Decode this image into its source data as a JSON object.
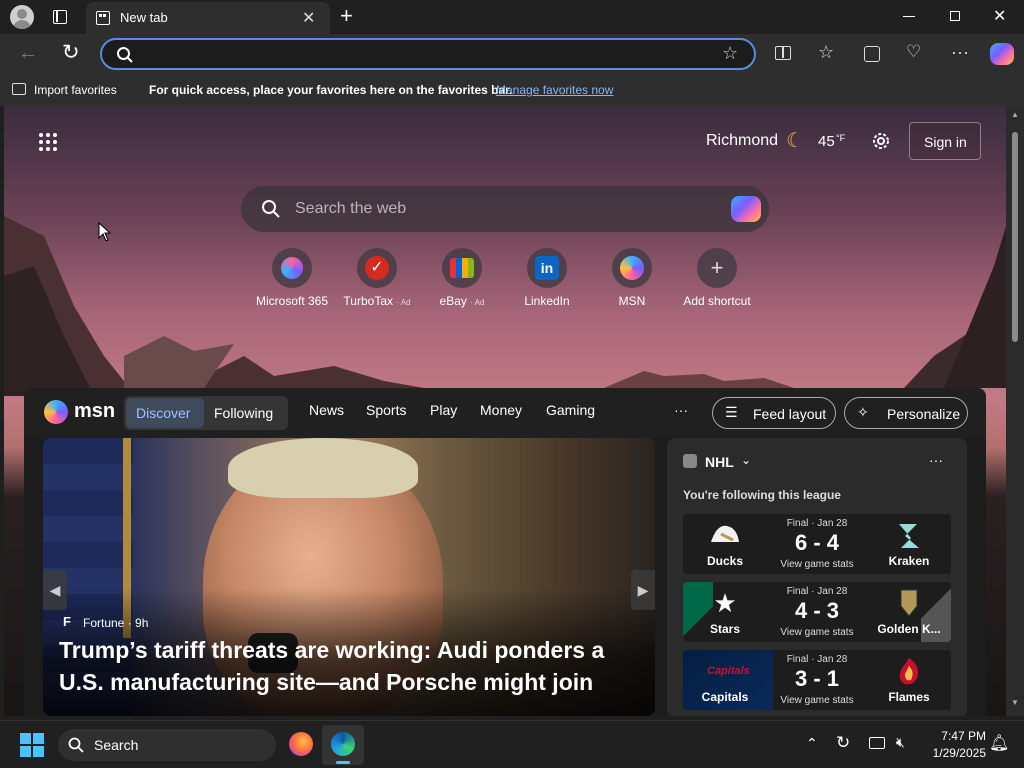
{
  "tab": {
    "title": "New tab",
    "new_tab_symbol": "+"
  },
  "address": {
    "value": "",
    "placeholder": ""
  },
  "favorites_bar": {
    "import_label": "Import favorites",
    "hint": "For quick access, place your favorites here on the favorites bar.",
    "manage_link": "Manage favorites now"
  },
  "weather": {
    "city": "Richmond",
    "temp": "45",
    "unit": "°F"
  },
  "sign_in_label": "Sign in",
  "web_search": {
    "placeholder": "Search the web"
  },
  "shortcuts": [
    {
      "label": "Microsoft 365",
      "ad": ""
    },
    {
      "label": "TurboTax",
      "ad": "· Ad"
    },
    {
      "label": "eBay",
      "ad": "· Ad"
    },
    {
      "label": "LinkedIn",
      "ad": ""
    },
    {
      "label": "MSN",
      "ad": ""
    },
    {
      "label": "Add shortcut",
      "ad": ""
    }
  ],
  "feed": {
    "brand": "msn",
    "tabs": [
      "Discover",
      "Following"
    ],
    "nav": [
      "News",
      "Sports",
      "Play",
      "Money",
      "Gaming"
    ],
    "more": "···",
    "feed_layout_label": "Feed layout",
    "personalize_label": "Personalize"
  },
  "hero": {
    "source_initial": "F",
    "source": "Fortune · 9h",
    "headline": "Trump’s tariff threats are working: Audi ponders a U.S. manufacturing site—and Porsche might join"
  },
  "nhl": {
    "league": "NHL",
    "subtitle": "You're following this league",
    "more": "···",
    "games": [
      {
        "status": "Final · Jan 28",
        "team1": "Ducks",
        "score": "6 - 4",
        "team2": "Kraken",
        "stats": "View game stats"
      },
      {
        "status": "Final · Jan 28",
        "team1": "Stars",
        "score": "4 - 3",
        "team2": "Golden K...",
        "stats": "View game stats"
      },
      {
        "status": "Final · Jan 28",
        "team1": "Capitals",
        "score": "3 - 1",
        "team2": "Flames",
        "stats": "View game stats"
      }
    ]
  },
  "taskbar": {
    "search_label": "Search",
    "time": "7:47 PM",
    "date": "1/29/2025"
  },
  "colors": {
    "accent": "#5b8be0",
    "link": "#8ab4f8",
    "discover": "#9fc2ff"
  }
}
